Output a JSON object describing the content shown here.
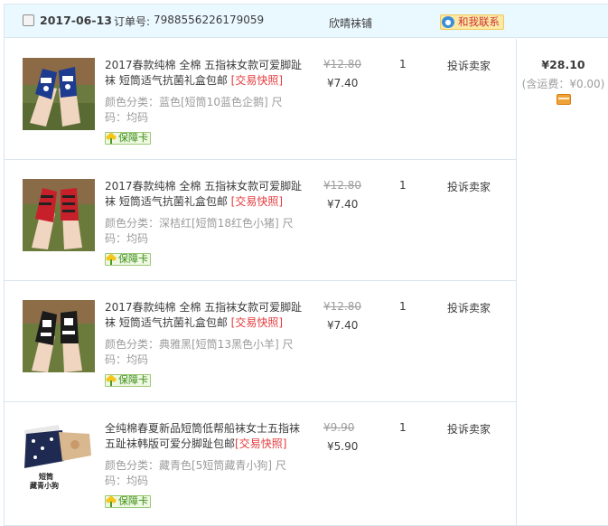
{
  "order": {
    "date": "2017-06-13",
    "order_no_label": "订单号:",
    "order_no": "7988556226179059",
    "shop_name": "欣晴袜铺",
    "contact_label": "和我联系",
    "total": "¥28.10",
    "shipping": "(含运费：¥0.00)"
  },
  "items": [
    {
      "title": "2017春款纯棉 全棉 五指袜女款可爱脚趾袜 短筒适气抗菌礼盒包邮",
      "snapshot": "[交易快照]",
      "sku": "颜色分类：蓝色[短筒10蓝色企鹅]  尺码：均码",
      "badge": "保障卡",
      "orig_price": "¥12.80",
      "price": "¥7.40",
      "qty": "1",
      "action": "投诉卖家"
    },
    {
      "title": "2017春款纯棉 全棉 五指袜女款可爱脚趾袜 短筒适气抗菌礼盒包邮",
      "snapshot": "[交易快照]",
      "sku": "颜色分类：深桔红[短筒18红色小猪]  尺码：均码",
      "badge": "保障卡",
      "orig_price": "¥12.80",
      "price": "¥7.40",
      "qty": "1",
      "action": "投诉卖家"
    },
    {
      "title": "2017春款纯棉 全棉 五指袜女款可爱脚趾袜 短筒适气抗菌礼盒包邮",
      "snapshot": "[交易快照]",
      "sku": "颜色分类：典雅黑[短筒13黑色小羊]  尺码：均码",
      "badge": "保障卡",
      "orig_price": "¥12.80",
      "price": "¥7.40",
      "qty": "1",
      "action": "投诉卖家"
    },
    {
      "title": "全纯棉春夏新品短筒低帮船袜女士五指袜五趾袜韩版可爱分脚趾包邮",
      "snapshot": "[交易快照]",
      "sku": "颜色分类：藏青色[5短筒藏青小狗]  尺码：均码",
      "badge": "保障卡",
      "orig_price": "¥9.90",
      "price": "¥5.90",
      "qty": "1",
      "action": "投诉卖家",
      "thumb_caption_1": "短筒",
      "thumb_caption_2": "藏青小狗"
    }
  ],
  "colors": {
    "header_bg": "#eaf8ff",
    "border": "#d8e6f0",
    "snapshot_red": "#e4393c",
    "badge_green": "#3e8e1b"
  },
  "icons": [
    "checkbox",
    "chat-bubble-icon",
    "flower-icon",
    "card-icon"
  ]
}
